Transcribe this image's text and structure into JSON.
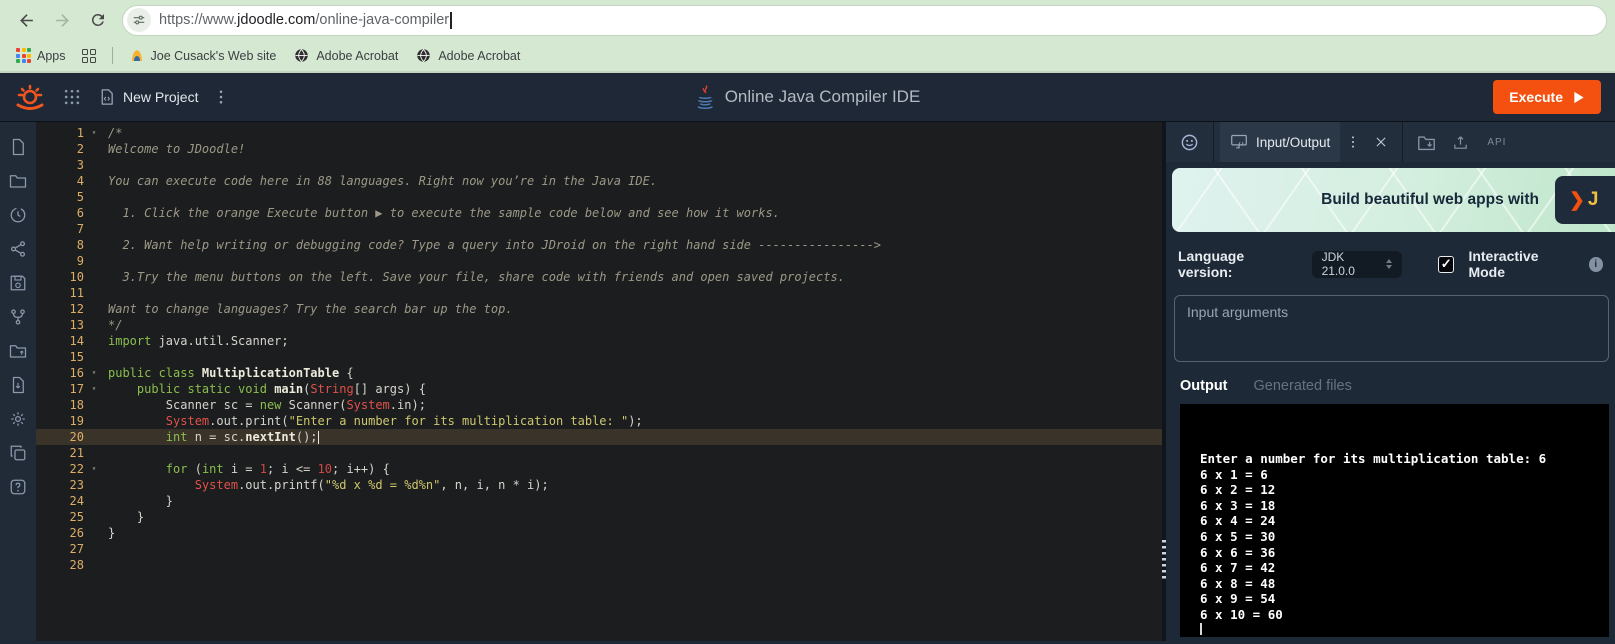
{
  "browser": {
    "url_prefix": "https://www.",
    "url_domain": "jdoodle.com",
    "url_path": "/online-java-compiler",
    "apps_label": "Apps",
    "bookmarks": [
      {
        "label": "Joe Cusack's Web site",
        "icon": "hostgator-icon"
      },
      {
        "label": "Adobe Acrobat",
        "icon": "globe-icon"
      },
      {
        "label": "Adobe Acrobat",
        "icon": "globe-icon"
      }
    ]
  },
  "header": {
    "project_name": "New Project",
    "title": "Online Java Compiler IDE",
    "execute_label": "Execute"
  },
  "sidebar": {
    "icons": [
      "file-icon",
      "folder-icon",
      "history-icon",
      "share-icon",
      "save-icon",
      "fork-icon",
      "folder-upload-icon",
      "file-download-icon",
      "settings-gear-icon",
      "copy-icon",
      "help-icon"
    ]
  },
  "editor": {
    "active_line": 20,
    "fold_lines": [
      1,
      16,
      17,
      22
    ],
    "lines": [
      [
        {
          "c": "comment",
          "t": "/*"
        }
      ],
      [
        {
          "c": "comment",
          "t": "Welcome to JDoodle!"
        }
      ],
      [],
      [
        {
          "c": "comment",
          "t": "You can execute code here in 88 languages. Right now you’re in the Java IDE."
        }
      ],
      [],
      [
        {
          "c": "comment",
          "t": "  1. Click the orange Execute button ▶ to execute the sample code below and see how it works."
        }
      ],
      [],
      [
        {
          "c": "comment",
          "t": "  2. Want help writing or debugging code? Type a query into JDroid on the right hand side ---------------->"
        }
      ],
      [],
      [
        {
          "c": "comment",
          "t": "  3.Try the menu buttons on the left. Save your file, share code with friends and open saved projects."
        }
      ],
      [],
      [
        {
          "c": "comment",
          "t": "Want to change languages? Try the search bar up the top."
        }
      ],
      [
        {
          "c": "comment",
          "t": "*/"
        }
      ],
      [
        {
          "c": "kw",
          "t": "import"
        },
        {
          "c": "plain",
          "t": " java.util.Scanner;"
        }
      ],
      [],
      [
        {
          "c": "kw",
          "t": "public class "
        },
        {
          "c": "bold",
          "t": "MultiplicationTable"
        },
        {
          "c": "plain",
          "t": " {"
        }
      ],
      [
        {
          "c": "plain",
          "t": "    "
        },
        {
          "c": "kw",
          "t": "public static void "
        },
        {
          "c": "bold",
          "t": "main"
        },
        {
          "c": "plain",
          "t": "("
        },
        {
          "c": "type",
          "t": "String"
        },
        {
          "c": "plain",
          "t": "[] args) {"
        }
      ],
      [
        {
          "c": "plain",
          "t": "        Scanner sc = "
        },
        {
          "c": "kw",
          "t": "new"
        },
        {
          "c": "plain",
          "t": " Scanner("
        },
        {
          "c": "type",
          "t": "System"
        },
        {
          "c": "plain",
          "t": ".in);"
        }
      ],
      [
        {
          "c": "plain",
          "t": "        "
        },
        {
          "c": "type",
          "t": "System"
        },
        {
          "c": "plain",
          "t": ".out.print("
        },
        {
          "c": "str",
          "t": "\"Enter a number for its multiplication table: \""
        },
        {
          "c": "plain",
          "t": ");"
        }
      ],
      [
        {
          "c": "plain",
          "t": "        "
        },
        {
          "c": "kw",
          "t": "int"
        },
        {
          "c": "plain",
          "t": " n = sc."
        },
        {
          "c": "bold",
          "t": "nextInt"
        },
        {
          "c": "plain",
          "t": "();"
        }
      ],
      [],
      [
        {
          "c": "plain",
          "t": "        "
        },
        {
          "c": "kw",
          "t": "for"
        },
        {
          "c": "plain",
          "t": " ("
        },
        {
          "c": "kw",
          "t": "int"
        },
        {
          "c": "plain",
          "t": " i = "
        },
        {
          "c": "num",
          "t": "1"
        },
        {
          "c": "plain",
          "t": "; i <= "
        },
        {
          "c": "num",
          "t": "10"
        },
        {
          "c": "plain",
          "t": "; i++) {"
        }
      ],
      [
        {
          "c": "plain",
          "t": "            "
        },
        {
          "c": "type",
          "t": "System"
        },
        {
          "c": "plain",
          "t": ".out.printf("
        },
        {
          "c": "str",
          "t": "\"%d x %d = %d%n\""
        },
        {
          "c": "plain",
          "t": ", n, i, n * i);"
        }
      ],
      [
        {
          "c": "plain",
          "t": "        }"
        }
      ],
      [
        {
          "c": "plain",
          "t": "    }"
        }
      ],
      [
        {
          "c": "plain",
          "t": "}"
        }
      ],
      [],
      []
    ]
  },
  "panel": {
    "io_tab_label": "Input/Output",
    "api_label": "API",
    "banner_text": "Build beautiful web apps with",
    "language_label": "Language version:",
    "language_value": "JDK 21.0.0",
    "interactive_label": "Interactive Mode",
    "input_placeholder": "Input arguments",
    "tabs": [
      {
        "label": "Output",
        "active": true
      },
      {
        "label": "Generated files",
        "active": false
      }
    ],
    "terminal_lines": [
      "Enter a number for its multiplication table: 6",
      "6 x 1 = 6",
      "6 x 2 = 12",
      "6 x 3 = 18",
      "6 x 4 = 24",
      "6 x 5 = 30",
      "6 x 6 = 36",
      "6 x 7 = 42",
      "6 x 8 = 48",
      "6 x 9 = 54",
      "6 x 10 = 60"
    ]
  },
  "colors": {
    "chrome_green": "#d5e8d2",
    "header_navy": "#1e2836",
    "accent_orange": "#f4500f",
    "keyword_green": "#8abf4d",
    "type_red": "#e0514a",
    "string_olive": "#cfc76d",
    "line_number_gold": "#dcae66",
    "terminal_black": "#000000"
  }
}
